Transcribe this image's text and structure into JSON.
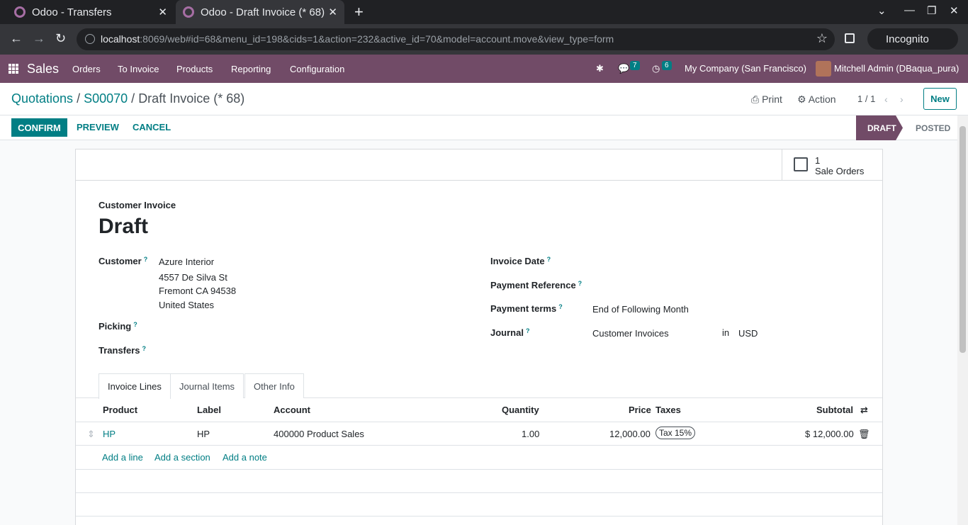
{
  "browser": {
    "tabs": [
      {
        "title": "Odoo - Transfers"
      },
      {
        "title": "Odoo - Draft Invoice (* 68)"
      }
    ],
    "url_host": "localhost",
    "url_rest": ":8069/web#id=68&menu_id=198&cids=1&action=232&active_id=70&model=account.move&view_type=form",
    "incognito_label": "Incognito"
  },
  "nav": {
    "app": "Sales",
    "menus": [
      "Orders",
      "To Invoice",
      "Products",
      "Reporting",
      "Configuration"
    ],
    "messages_count": "7",
    "activities_count": "6",
    "company": "My Company (San Francisco)",
    "user": "Mitchell Admin (DBaqua_pura)"
  },
  "control_panel": {
    "breadcrumb": [
      "Quotations",
      "S00070",
      "Draft Invoice (* 68)"
    ],
    "print_label": "Print",
    "action_label": "Action",
    "pager": "1 / 1",
    "new_label": "New"
  },
  "statusbar": {
    "confirm": "CONFIRM",
    "preview": "PREVIEW",
    "cancel": "CANCEL",
    "stages": [
      "DRAFT",
      "POSTED"
    ]
  },
  "smart_button": {
    "count": "1",
    "label": "Sale Orders"
  },
  "form": {
    "type_label": "Customer Invoice",
    "state_title": "Draft",
    "customer_label": "Customer",
    "customer_lines": [
      "Azure Interior",
      "4557 De Silva St",
      "Fremont CA 94538",
      "United States"
    ],
    "picking_label": "Picking",
    "transfers_label": "Transfers",
    "invoice_date_label": "Invoice Date",
    "payment_ref_label": "Payment Reference",
    "payment_terms_label": "Payment terms",
    "payment_terms_value": "End of Following Month",
    "journal_label": "Journal",
    "journal_value": "Customer Invoices",
    "in_label": "in",
    "currency": "USD"
  },
  "tabs": [
    "Invoice Lines",
    "Journal Items",
    "Other Info"
  ],
  "lines": {
    "headers": [
      "Product",
      "Label",
      "Account",
      "Quantity",
      "Price",
      "Taxes",
      "Subtotal"
    ],
    "rows": [
      {
        "product": "HP",
        "label": "HP",
        "account": "400000 Product Sales",
        "quantity": "1.00",
        "price": "12,000.00",
        "tax": "Tax 15%",
        "subtotal": "$ 12,000.00"
      }
    ],
    "add_line": "Add a line",
    "add_section": "Add a section",
    "add_note": "Add a note"
  }
}
